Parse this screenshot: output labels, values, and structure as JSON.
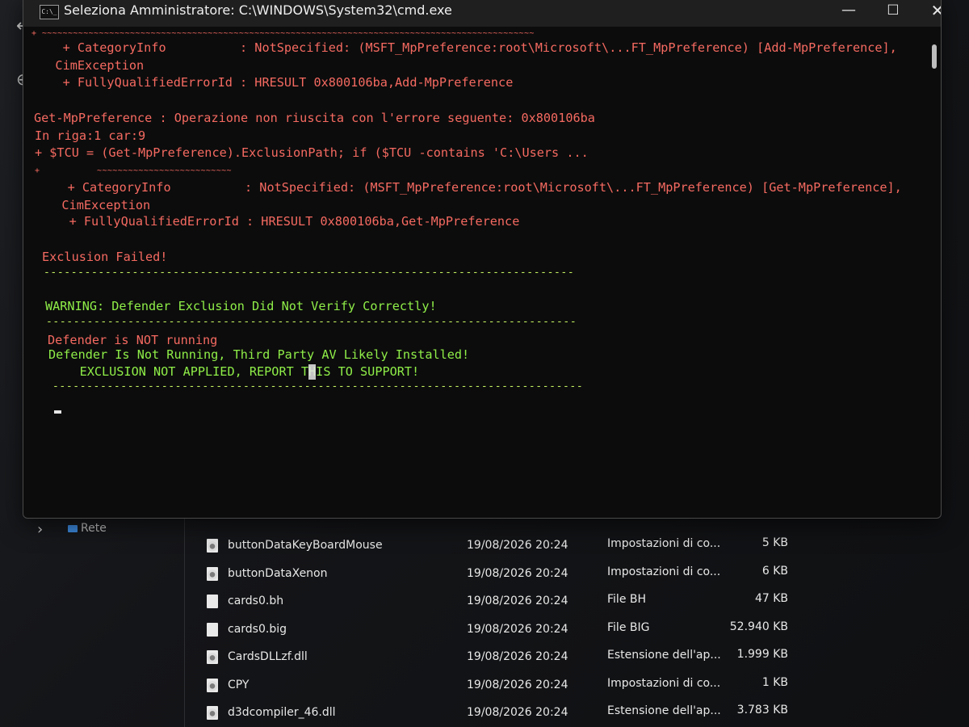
{
  "explorer": {
    "back_icon": "arrow-left-icon",
    "new_icon": "plus-circle-icon",
    "nav_label_network": "Rete",
    "files": [
      {
        "name": "buttonDataKeyBoardMouse",
        "date": "19/08/2026 20:24",
        "type": "Impostazioni di co...",
        "size": "5 KB",
        "icon": "settings-file-icon"
      },
      {
        "name": "buttonDataXenon",
        "date": "19/08/2026 20:24",
        "type": "Impostazioni di co...",
        "size": "6 KB",
        "icon": "settings-file-icon"
      },
      {
        "name": "cards0.bh",
        "date": "19/08/2026 20:24",
        "type": "File BH",
        "size": "47 KB",
        "icon": "file-icon"
      },
      {
        "name": "cards0.big",
        "date": "19/08/2026 20:24",
        "type": "File BIG",
        "size": "52.940 KB",
        "icon": "file-icon"
      },
      {
        "name": "CardsDLLzf.dll",
        "date": "19/08/2026 20:24",
        "type": "Estensione dell'ap...",
        "size": "1.999 KB",
        "icon": "dll-file-icon"
      },
      {
        "name": "CPY",
        "date": "19/08/2026 20:24",
        "type": "Impostazioni di co...",
        "size": "1 KB",
        "icon": "settings-file-icon"
      },
      {
        "name": "d3dcompiler_46.dll",
        "date": "19/08/2026 20:24",
        "type": "Estensione dell'ap...",
        "size": "3.783 KB",
        "icon": "dll-file-icon"
      }
    ]
  },
  "cmd": {
    "title": "Seleziona Amministratore: C:\\WINDOWS\\System32\\cmd.exe",
    "app_icon_text": "C:\\_",
    "controls": {
      "minimize": "—",
      "maximize": "☐",
      "close": "✕"
    },
    "lines": [
      {
        "text": "+ ~~~~~~~~~~~~~~~~~~~~~~~~~~~~~~~~~~~~~~~~~~~~~~~~~~~~~~~~~~~~~~~~~~~~~~~~~~~~~~~~~~~~~~~~~~~~~~~",
        "style": "red"
      },
      {
        "text": "    + CategoryInfo          : NotSpecified: (MSFT_MpPreference:root\\Microsoft\\...FT_MpPreference) [Add-MpPreference],",
        "style": "red"
      },
      {
        "text": "   CimException",
        "style": "red"
      },
      {
        "text": "    + FullyQualifiedErrorId : HRESULT 0x800106ba,Add-MpPreference",
        "style": "red"
      },
      {
        "text": "Get-MpPreference : Operazione non riuscita con l'errore seguente: 0x800106ba",
        "style": "red"
      },
      {
        "text": "In riga:1 car:9",
        "style": "red"
      },
      {
        "text": "+ $TCU = (Get-MpPreference).ExclusionPath; if ($TCU -contains 'C:\\Users ...",
        "style": "red"
      },
      {
        "text": "+           ~~~~~~~~~~~~~~~~~~~~~~~~~~",
        "style": "red"
      },
      {
        "text": "    + CategoryInfo          : NotSpecified: (MSFT_MpPreference:root\\Microsoft\\...FT_MpPreference) [Get-MpPreference],",
        "style": "red"
      },
      {
        "text": "   CimException",
        "style": "red"
      },
      {
        "text": "    + FullyQualifiedErrorId : HRESULT 0x800106ba,Get-MpPreference",
        "style": "red"
      },
      {
        "text": "Exclusion Failed!",
        "style": "red"
      },
      {
        "text": "------------------------------------------------------------------------------",
        "style": "green"
      },
      {
        "text": "WARNING: Defender Exclusion Did Not Verify Correctly!",
        "style": "green"
      },
      {
        "text": "------------------------------------------------------------------------------",
        "style": "green"
      },
      {
        "text": "Defender is NOT running",
        "style": "red"
      },
      {
        "text": "Defender Is Not Running, Third Party AV Likely Installed!",
        "style": "green"
      },
      {
        "text": "    EXCLUSION NOT APPLIED, REPORT THIS TO SUPPORT!",
        "style": "green"
      },
      {
        "text": "------------------------------------------------------------------------------",
        "style": "green"
      }
    ]
  }
}
